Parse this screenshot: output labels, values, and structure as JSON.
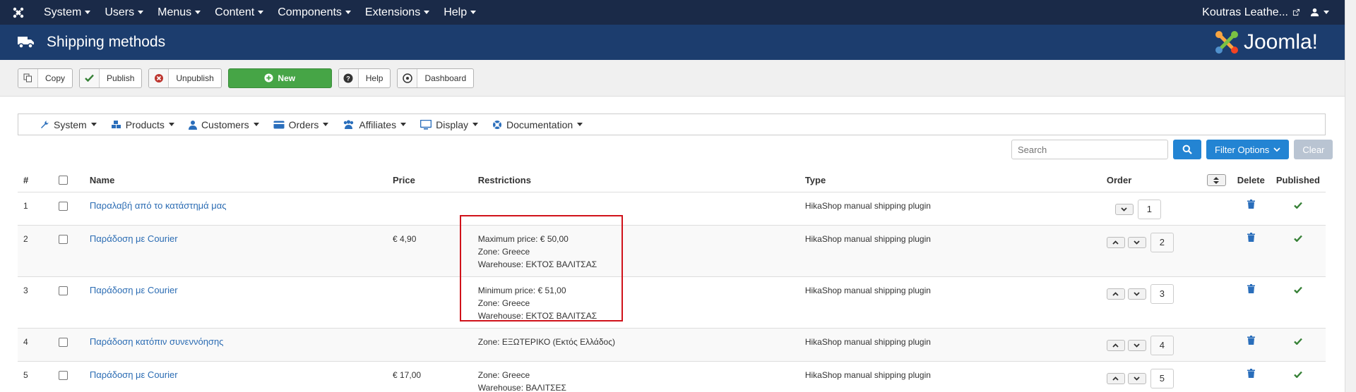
{
  "topnav": {
    "menu": [
      {
        "label": "System"
      },
      {
        "label": "Users"
      },
      {
        "label": "Menus"
      },
      {
        "label": "Content"
      },
      {
        "label": "Components"
      },
      {
        "label": "Extensions"
      },
      {
        "label": "Help"
      }
    ],
    "site_name": "Koutras Leathe..."
  },
  "header": {
    "title": "Shipping methods",
    "brand": "Joomla!"
  },
  "toolbar": {
    "copy": "Copy",
    "publish": "Publish",
    "unpublish": "Unpublish",
    "new": "New",
    "help": "Help",
    "dashboard": "Dashboard"
  },
  "submenu": [
    {
      "label": "System",
      "icon": "wrench-icon"
    },
    {
      "label": "Products",
      "icon": "cubes-icon"
    },
    {
      "label": "Customers",
      "icon": "user-icon"
    },
    {
      "label": "Orders",
      "icon": "credit-card-icon"
    },
    {
      "label": "Affiliates",
      "icon": "users-icon"
    },
    {
      "label": "Display",
      "icon": "monitor-icon"
    },
    {
      "label": "Documentation",
      "icon": "life-ring-icon"
    }
  ],
  "search": {
    "placeholder": "Search",
    "filter_label": "Filter Options",
    "clear_label": "Clear"
  },
  "table": {
    "headers": {
      "num": "#",
      "name": "Name",
      "price": "Price",
      "restrictions": "Restrictions",
      "type": "Type",
      "order": "Order",
      "delete": "Delete",
      "published": "Published"
    },
    "rows": [
      {
        "num": "1",
        "name": "Παραλαβή από το κατάστημά μας",
        "price": "",
        "restrictions": [],
        "type": "HikaShop manual shipping plugin",
        "order": "1"
      },
      {
        "num": "2",
        "name": "Παράδοση με Courier",
        "price": "€ 4,90",
        "restrictions": [
          "Maximum price: € 50,00",
          "Zone: Greece",
          "Warehouse: ΕΚΤΟΣ ΒΑΛΙΤΣΑΣ"
        ],
        "type": "HikaShop manual shipping plugin",
        "order": "2"
      },
      {
        "num": "3",
        "name": "Παράδοση με Courier",
        "price": "",
        "restrictions": [
          "Minimum price: € 51,00",
          "Zone: Greece",
          "Warehouse: ΕΚΤΟΣ ΒΑΛΙΤΣΑΣ"
        ],
        "type": "HikaShop manual shipping plugin",
        "order": "3"
      },
      {
        "num": "4",
        "name": "Παράδοση κατόπιν συνεννόησης",
        "price": "",
        "restrictions": [
          "Zone: ΕΞΩΤΕΡΙΚΟ (Εκτός Ελλάδος)"
        ],
        "type": "HikaShop manual shipping plugin",
        "order": "4"
      },
      {
        "num": "5",
        "name": "Παράδοση με Courier",
        "price": "€ 17,00",
        "restrictions": [
          "Zone: Greece",
          "Warehouse: ΒΑΛΙΤΣΕΣ"
        ],
        "type": "HikaShop manual shipping plugin",
        "order": "5"
      }
    ]
  },
  "colors": {
    "topnav_bg": "#1a2a48",
    "header_bg": "#1c3d6e",
    "primary": "#2384d3",
    "success": "#46a546",
    "link": "#2b6cb3",
    "highlight": "#d0121a"
  }
}
